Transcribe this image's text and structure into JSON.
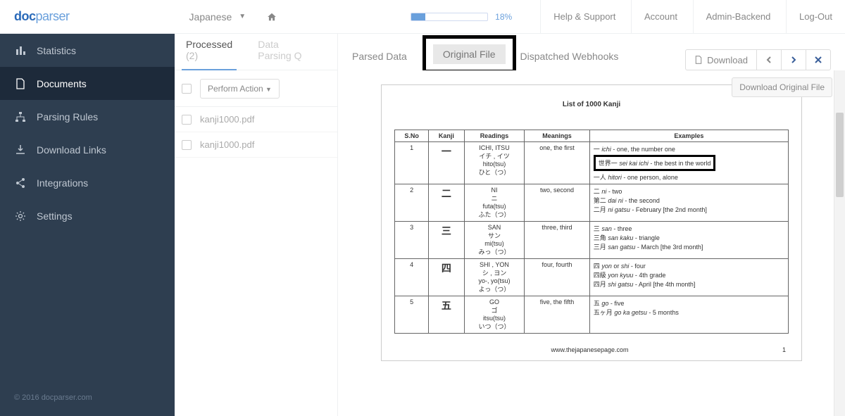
{
  "brand": {
    "a": "doc",
    "b": "parser"
  },
  "breadcrumb": "Japanese",
  "progress": {
    "pct": "18%"
  },
  "nav": {
    "help": "Help & Support",
    "account": "Account",
    "admin": "Admin-Backend",
    "logout": "Log-Out"
  },
  "sidebar": {
    "statistics": "Statistics",
    "documents": "Documents",
    "parsing_rules": "Parsing Rules",
    "download_links": "Download Links",
    "integrations": "Integrations",
    "settings": "Settings",
    "footer": "© 2016 docparser.com"
  },
  "filelist": {
    "tab_processed": "Processed",
    "tab_processed_count": "(2)",
    "tab_queue": "Data Parsing Q",
    "perform_action": "Perform Action ",
    "rows": [
      "kanji1000.pdf",
      "kanji1000.pdf"
    ]
  },
  "ctabs": {
    "parsed": "Parsed Data",
    "original": "Original File",
    "webhooks": "Dispatched Webhooks"
  },
  "toolbar": {
    "download": "Download"
  },
  "download_original": "Download Original File",
  "doc": {
    "title": "List of 1000 Kanji",
    "headers": [
      "S.No",
      "Kanji",
      "Readings",
      "Meanings",
      "Examples"
    ],
    "rows": [
      {
        "no": "1",
        "kanji": "一",
        "readings": "ICHI, ITSU<br>イチ , イツ<br>hito(tsu)<br>ひと（つ）",
        "mean": "one, the first",
        "ex": "一 <i>ichi</i>  - one, the number one",
        "ex_hl": "世界一 <i>sei kai ichi</i>  - the best in the world",
        "ex_after": "一人 <i>hitori</i>  - one person, alone"
      },
      {
        "no": "2",
        "kanji": "二",
        "readings": "NI<br>ニ<br>futa(tsu)<br>ふた（つ）",
        "mean": "two, second",
        "ex": "二 <i>ni</i>  - two<br>第二 <i>dai ni</i>  - the second<br>二月 <i>ni gatsu</i>  - February [the 2nd month]"
      },
      {
        "no": "3",
        "kanji": "三",
        "readings": "SAN<br>サン<br>mi(tsu)<br>みっ（つ）",
        "mean": "three, third",
        "ex": "三 <i>san</i>  - three<br>三角 <i>san kaku</i>  - triangle<br>三月 <i>san gatsu</i>  - March [the 3rd month]"
      },
      {
        "no": "4",
        "kanji": "四",
        "readings": "SHI , YON<br>シ , ヨン<br>yo-, yo(tsu)<br>よっ（つ）",
        "mean": "four, fourth",
        "ex": "四 <i>yon</i> or <i>shi</i>  - four<br>四級 <i>yon kyuu</i>  - 4th grade<br>四月 <i>shi gatsu</i>  - April [the 4th month]"
      },
      {
        "no": "5",
        "kanji": "五",
        "readings": "GO<br>ゴ<br>itsu(tsu)<br>いつ（つ）",
        "mean": "five, the fifth",
        "ex": "五 <i>go</i>  - five<br>五ヶ月 <i>go ka getsu</i>  - 5 months"
      }
    ],
    "footer_site": "www.thejapanesepage.com",
    "footer_pg": "1"
  }
}
